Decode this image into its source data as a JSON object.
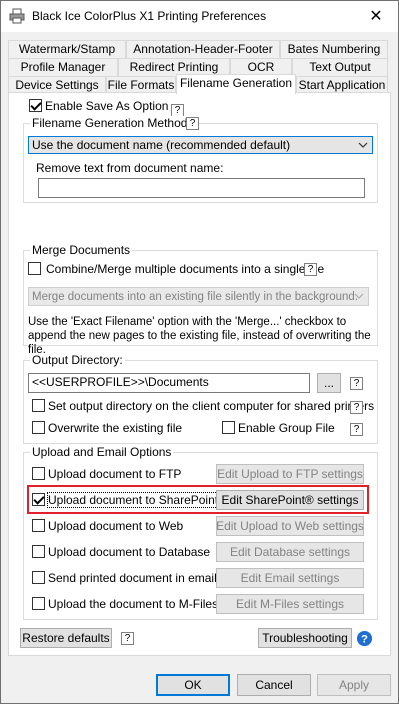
{
  "window": {
    "title": "Black Ice ColorPlus X1 Printing Preferences",
    "close_glyph": "✕",
    "app_icon": "printer-icon"
  },
  "tabs": {
    "row1": [
      "Watermark/Stamp",
      "Annotation-Header-Footer",
      "Bates Numbering"
    ],
    "row2": [
      "Profile Manager",
      "Redirect Printing",
      "OCR",
      "Text Output"
    ],
    "row3": [
      "Device Settings",
      "File Formats",
      "Filename Generation",
      "Start Application"
    ],
    "active": "Filename Generation"
  },
  "enable_save_as": {
    "label": "Enable Save As Option",
    "checked": true
  },
  "help_glyph": "?",
  "filename_methods": {
    "group_label": "Filename Generation Methods",
    "selected": "Use the document name (recommended default)",
    "remove_label": "Remove text from document name:",
    "remove_value": ""
  },
  "merge": {
    "group_label": "Merge Documents",
    "combine_label": "Combine/Merge multiple documents into a single file",
    "combine_checked": false,
    "mode_selected": "Merge documents into an existing file silently in the background.",
    "info": "Use the 'Exact Filename' option with the 'Merge...' checkbox to append the new pages to the existing file, instead of overwriting the file."
  },
  "output": {
    "group_label": "Output Directory:",
    "path": "<<USERPROFILE>>\\Documents",
    "browse_label": "...",
    "client_label": "Set output directory on the client computer for shared printers",
    "client_checked": false,
    "overwrite_label": "Overwrite the existing file",
    "overwrite_checked": false,
    "group_file_label": "Enable Group File",
    "group_file_checked": false
  },
  "upload": {
    "group_label": "Upload and Email Options",
    "items": [
      {
        "label": "Upload document to FTP",
        "checked": false,
        "button": "Edit Upload to FTP settings",
        "enabled": false
      },
      {
        "label": "Upload document to SharePoint®",
        "checked": true,
        "button": "Edit SharePoint® settings",
        "enabled": true
      },
      {
        "label": "Upload document to Web",
        "checked": false,
        "button": "Edit Upload to Web settings",
        "enabled": false
      },
      {
        "label": "Upload document to Database",
        "checked": false,
        "button": "Edit Database settings",
        "enabled": false
      },
      {
        "label": "Send printed document in email",
        "checked": false,
        "button": "Edit Email settings",
        "enabled": false
      },
      {
        "label": "Upload the document to M-Files",
        "checked": false,
        "button": "Edit M-Files settings",
        "enabled": false
      }
    ]
  },
  "footer": {
    "restore_label": "Restore defaults",
    "troubleshooting_label": "Troubleshooting",
    "info_icon": "question-circle-icon"
  },
  "dialog_buttons": {
    "ok": "OK",
    "cancel": "Cancel",
    "apply": "Apply"
  },
  "colors": {
    "accent": "#0078d7",
    "highlight": "#e0202b",
    "info_icon": "#1e6fd0"
  }
}
